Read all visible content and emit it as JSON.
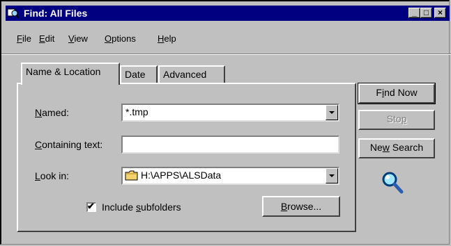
{
  "window": {
    "title": "Find: All Files",
    "minimize_glyph": "_",
    "maximize_glyph": "□",
    "close_glyph": "×"
  },
  "menu": [
    {
      "label": "File",
      "accel": "F",
      "rest": "ile"
    },
    {
      "label": "Edit",
      "accel": "E",
      "rest": "dit"
    },
    {
      "label": "View",
      "accel": "V",
      "rest": "iew"
    },
    {
      "label": "Options",
      "accel": "O",
      "rest": "ptions"
    },
    {
      "label": "Help",
      "accel": "H",
      "rest": "elp"
    }
  ],
  "tabs": [
    {
      "label": "Name & Location",
      "active": true
    },
    {
      "label": "Date",
      "active": false
    },
    {
      "label": "Advanced",
      "active": false
    }
  ],
  "form": {
    "named": {
      "label_accel": "N",
      "label_rest": "amed:",
      "value": "*.tmp"
    },
    "containing": {
      "label_accel": "C",
      "label_rest": "ontaining text:",
      "value": ""
    },
    "look_in": {
      "label_accel": "L",
      "label_rest": "ook in:",
      "value": "H:\\APPS\\ALSData",
      "icon": "folder-icon"
    },
    "include_subfolders": {
      "label_pre": "Include ",
      "label_accel": "s",
      "label_rest": "ubfolders",
      "checked": true,
      "mark": "✔"
    },
    "browse": {
      "accel": "B",
      "rest": "rowse..."
    }
  },
  "buttons": {
    "find_now": {
      "pre": "F",
      "accel": "i",
      "rest": "nd Now"
    },
    "stop": {
      "pre": "Sto",
      "accel": "p",
      "rest": ""
    },
    "new_search": {
      "pre": "Ne",
      "accel": "w",
      "rest": " Search"
    }
  },
  "colors": {
    "titlebar": "#000080",
    "face": "#c0c0c0",
    "folder": "#f4d26b"
  }
}
